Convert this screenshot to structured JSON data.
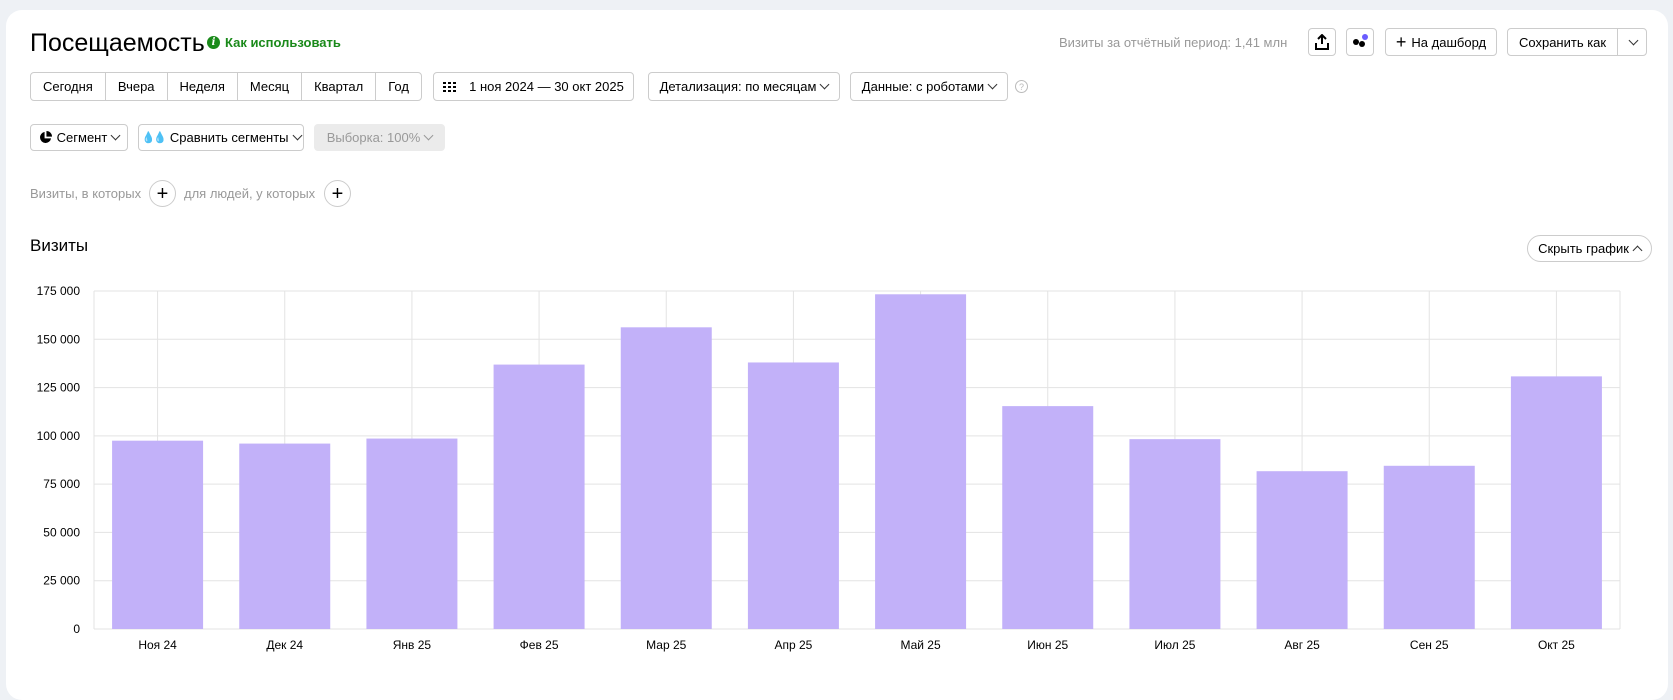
{
  "header": {
    "title": "Посещаемость",
    "how_to": "Как использовать",
    "period_total": "Визиты за отчётный период: 1,41 млн",
    "to_dashboard": "На дашборд",
    "save_as": "Сохранить как"
  },
  "periods": [
    "Сегодня",
    "Вчера",
    "Неделя",
    "Месяц",
    "Квартал",
    "Год"
  ],
  "date_range": "1 ноя 2024 — 30 окт 2025",
  "detail": "Детализация: по месяцам",
  "data_mode": "Данные: с роботами",
  "segment": "Сегмент",
  "compare": "Сравнить сегменты",
  "sample": "Выборка: 100%",
  "filters": {
    "visits": "Визиты, в которых",
    "people": "для людей, у которых"
  },
  "chart_section": {
    "title": "Визиты",
    "hide": "Скрыть график"
  },
  "colors": {
    "bar": "#c2b1f9",
    "link": "#1a8a1a",
    "dot": "#6a5cff"
  },
  "chart_data": {
    "type": "bar",
    "title": "Визиты",
    "xlabel": "",
    "ylabel": "",
    "categories": [
      "Ноя 24",
      "Дек 24",
      "Янв 25",
      "Фев 25",
      "Мар 25",
      "Апр 25",
      "Май 25",
      "Июн 25",
      "Июл 25",
      "Авг 25",
      "Сен 25",
      "Окт 25"
    ],
    "values": [
      97500,
      96000,
      98600,
      136900,
      156200,
      138000,
      173300,
      115400,
      98300,
      81700,
      84500,
      130800
    ],
    "ylim": [
      0,
      175000
    ],
    "yticks": [
      0,
      25000,
      50000,
      75000,
      100000,
      125000,
      150000,
      175000
    ],
    "ytick_labels": [
      "0",
      "25 000",
      "50 000",
      "75 000",
      "100 000",
      "125 000",
      "150 000",
      "175 000"
    ],
    "grid": true
  }
}
